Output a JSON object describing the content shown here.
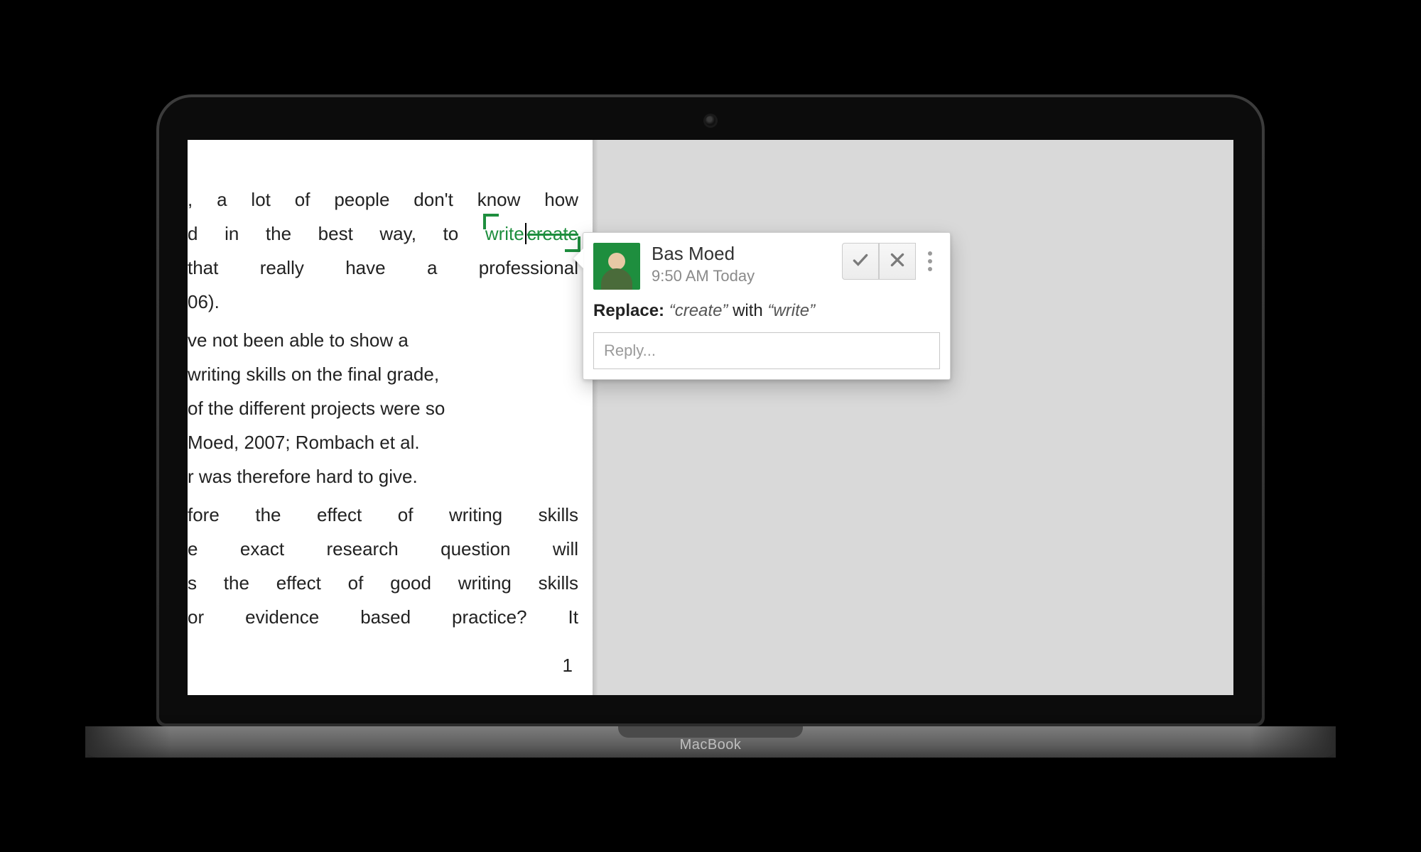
{
  "device": {
    "brand": "MacBook"
  },
  "document": {
    "page_number": "1",
    "paragraphs": {
      "p1a": ", a lot of people don't know how",
      "p1b_prefix": "d in the best way, to ",
      "p1c": "that  really  have  a  professional",
      "p1d": "06).",
      "p2a": "ve  not  been  able  to  show  a",
      "p2b": "writing skills on the final grade,",
      "p2c": "of the different projects were so",
      "p2d": "  Moed,  2007;  Rombach  et  al.",
      "p2e": "r was therefore hard to give.",
      "p3a": "fore  the  effect  of  writing  skills",
      "p3b": "e  exact  research  question  will",
      "p3c": "s the effect of good writing skills",
      "p3d": "or  evidence  based  practice?  It"
    },
    "suggestion_inline": {
      "new_word": "write",
      "old_word": "create"
    }
  },
  "comment": {
    "author": "Bas Moed",
    "timestamp": "9:50 AM Today",
    "action_label": "Replace:",
    "from_token": "“create”",
    "connector": " with ",
    "to_token": "“write”",
    "reply_placeholder": "Reply..."
  }
}
